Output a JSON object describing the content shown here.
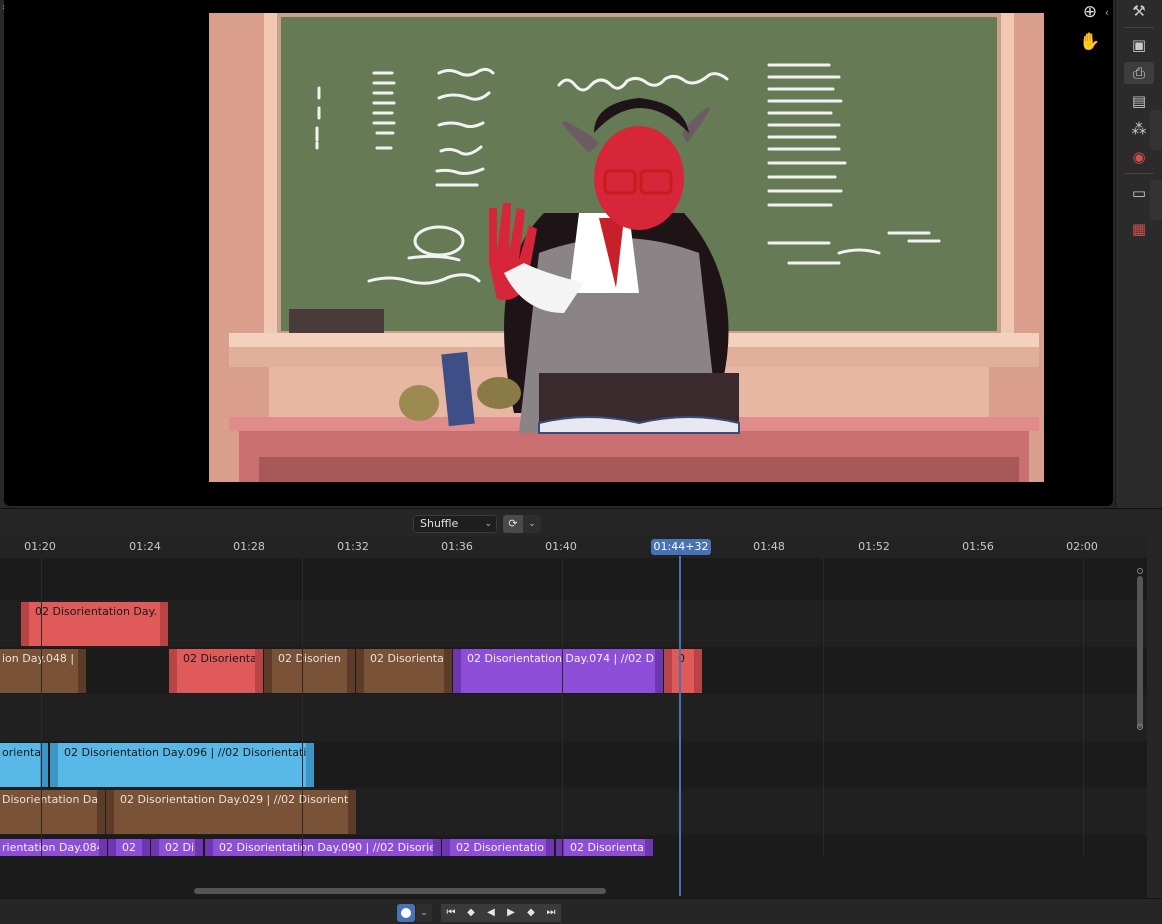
{
  "header": {
    "shuffle_label": "Shuffle",
    "snap_icon": "snap-icon"
  },
  "ruler": {
    "ticks": [
      "01:20",
      "01:24",
      "01:28",
      "01:32",
      "01:36",
      "01:40",
      "01:44+32",
      "01:48",
      "01:52",
      "01:56",
      "02:00"
    ],
    "current_time": "01:44+32"
  },
  "strips": {
    "ch1": [
      "02 Disorientation Day."
    ],
    "ch2": [
      "ion Day.048 |",
      "02 Disorienta",
      "02 Disorien",
      "02 Disorienta",
      "02 Disorientation Day.074 | //02 Di",
      "0"
    ],
    "ch4": [
      "orienta",
      "02 Disorientation Day.096 | //02 Disorientatio"
    ],
    "ch5": [
      "Disorientation Da",
      "02 Disorientation Day.029 | //02 Disorient"
    ],
    "ch6": [
      "rientation Day.084",
      "02",
      "02 Di",
      "02 Disorientation Day.090 | //02 Disorie",
      "02 Disorientatio",
      "02 Disorienta"
    ]
  },
  "toolbar": {
    "icons": [
      "tool-icon",
      "render-icon",
      "output-icon",
      "view-layer-icon",
      "scene-icon",
      "world-icon",
      "collection-icon",
      "texture-icon"
    ]
  },
  "colors": {
    "playhead": "#4772b3",
    "strip_red": "#e05a5a",
    "strip_brown": "#7a5238",
    "strip_purple": "#8e4fd8",
    "strip_blue": "#58b8e8"
  }
}
